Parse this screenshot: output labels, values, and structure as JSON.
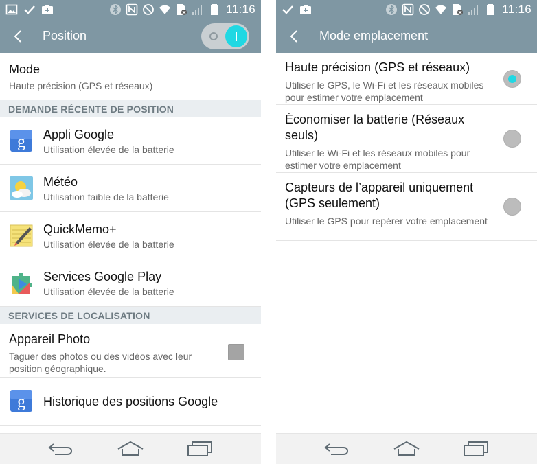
{
  "colors": {
    "bar": "#7f97a3",
    "accent": "#20d8e3",
    "section_bg": "#eaeef1"
  },
  "status_bar": {
    "time": "11:16",
    "left_icons": [
      "image-icon",
      "check-icon",
      "camera-add-icon"
    ],
    "right_icons": [
      "bluetooth-icon",
      "nfc-icon",
      "do-not-disturb-icon",
      "wifi-icon",
      "sim-blocked-icon",
      "signal-icon",
      "battery-icon"
    ]
  },
  "left": {
    "title": "Position",
    "toggle_on": true,
    "mode": {
      "title": "Mode",
      "value": "Haute précision (GPS et réseaux)"
    },
    "recent_header": "DEMANDE RÉCENTE DE POSITION",
    "recent": [
      {
        "name": "Appli Google",
        "usage": "Utilisation élevée de la batterie",
        "icon": "google-app-icon"
      },
      {
        "name": "Météo",
        "usage": "Utilisation faible de la batterie",
        "icon": "weather-icon"
      },
      {
        "name": "QuickMemo+",
        "usage": "Utilisation élevée de la batterie",
        "icon": "quickmemo-icon"
      },
      {
        "name": "Services Google Play",
        "usage": "Utilisation élevée de la batterie",
        "icon": "google-play-services-icon"
      }
    ],
    "services_header": "SERVICES DE LOCALISATION",
    "camera": {
      "title": "Appareil Photo",
      "desc": "Taguer des photos ou des vidéos avec leur position géographique.",
      "checked": false
    },
    "history": {
      "title": "Historique des positions Google",
      "icon": "google-app-icon"
    }
  },
  "right": {
    "title": "Mode emplacement",
    "options": [
      {
        "title": "Haute précision (GPS et réseaux)",
        "desc": "Utiliser le GPS, le Wi-Fi et les réseaux mobiles pour estimer votre emplacement",
        "selected": true
      },
      {
        "title": "Économiser la batterie (Réseaux seuls)",
        "desc": "Utiliser le Wi-Fi et les réseaux mobiles pour estimer votre emplacement",
        "selected": false
      },
      {
        "title": "Capteurs de l’appareil uniquement (GPS seulement)",
        "desc": "Utiliser le GPS pour repérer votre emplacement",
        "selected": false
      }
    ]
  },
  "nav": [
    "back-icon",
    "home-icon",
    "recent-apps-icon"
  ]
}
